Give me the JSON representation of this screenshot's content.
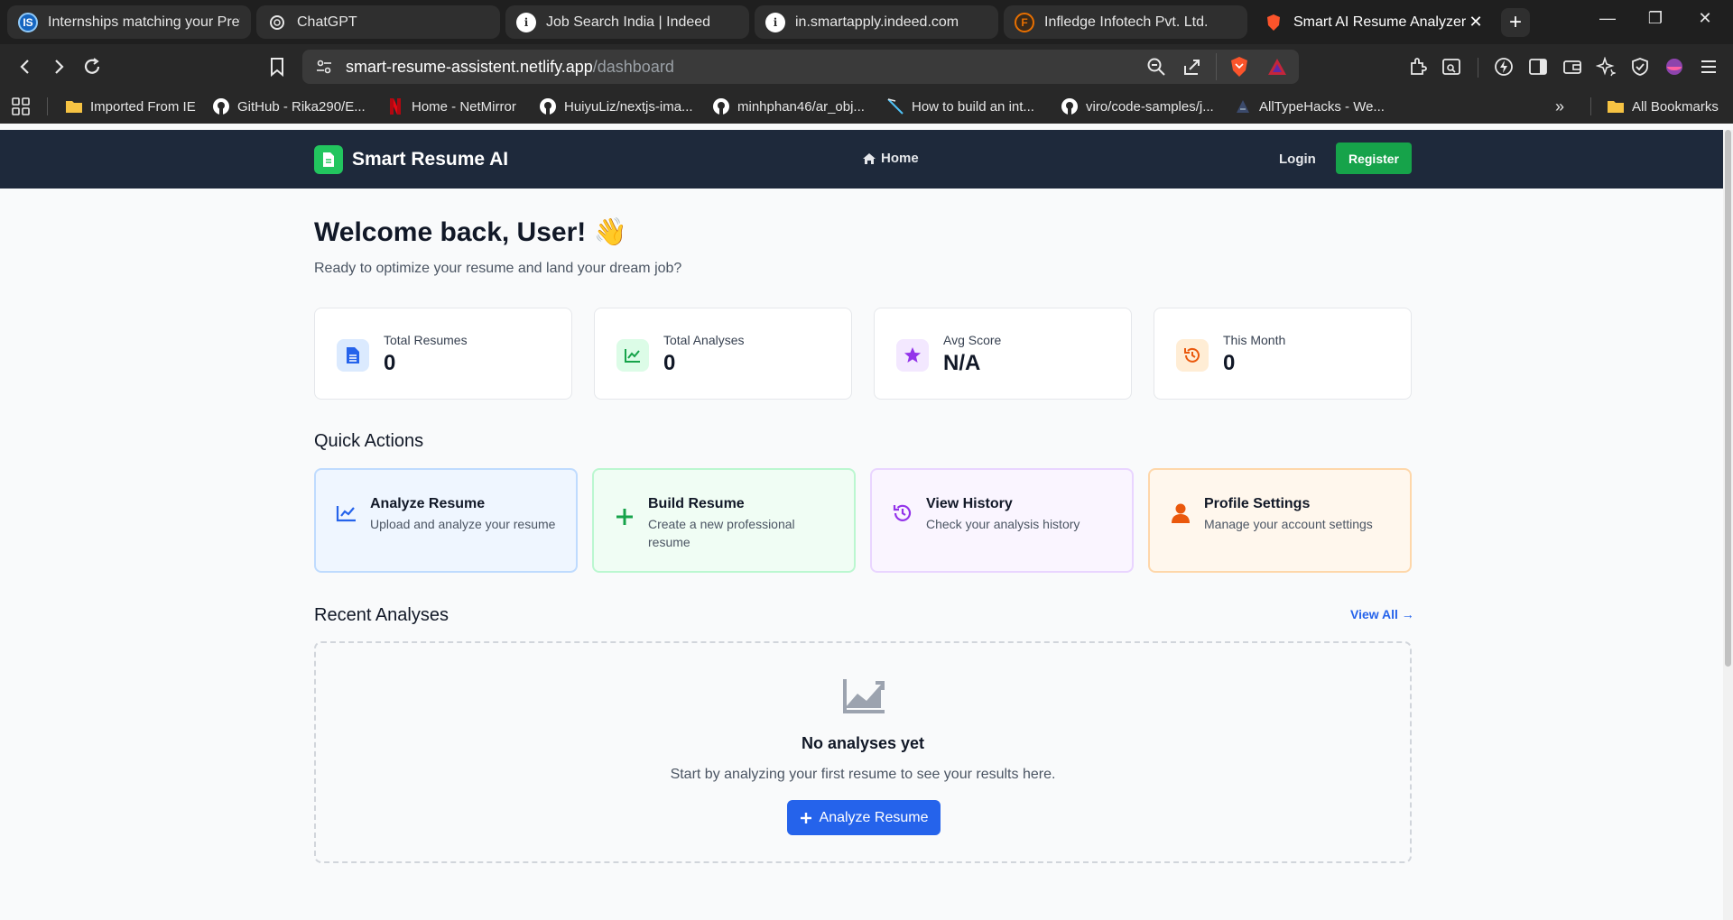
{
  "browser": {
    "tabs": [
      {
        "title": "Internships matching your Prefe",
        "favicon": "IS",
        "favicon_color": "#1565c0"
      },
      {
        "title": "ChatGPT",
        "favicon": "chatgpt-icon"
      },
      {
        "title": "Job Search India | Indeed",
        "favicon": "info-icon"
      },
      {
        "title": "in.smartapply.indeed.com",
        "favicon": "info-icon"
      },
      {
        "title": "Infledge Infotech Pvt. Ltd.",
        "favicon": "F",
        "favicon_color": "#e76f00"
      },
      {
        "title": "Smart AI Resume Analyzer",
        "favicon": "brave-icon",
        "active": true
      }
    ],
    "url": {
      "host": "smart-resume-assistent.netlify.app",
      "path": "/dashboard"
    },
    "bookmarks": [
      {
        "label": "Imported From IE",
        "icon": "folder-icon"
      },
      {
        "label": "GitHub - Rika290/E...",
        "icon": "github-icon"
      },
      {
        "label": "Home - NetMirror",
        "icon": "netflix-icon"
      },
      {
        "label": "HuiyuLiz/nextjs-ima...",
        "icon": "github-icon"
      },
      {
        "label": "minhphan46/ar_obj...",
        "icon": "github-icon"
      },
      {
        "label": "How to build an int...",
        "icon": "link-icon"
      },
      {
        "label": "viro/code-samples/j...",
        "icon": "github-icon"
      },
      {
        "label": "AllTypeHacks - We...",
        "icon": "site-icon"
      },
      {
        "label": "All Bookmarks",
        "icon": "folder-icon"
      }
    ]
  },
  "nav": {
    "brand": "Smart Resume AI",
    "home": "Home",
    "login": "Login",
    "register": "Register"
  },
  "welcome": {
    "title": "Welcome back, User! 👋",
    "subtitle": "Ready to optimize your resume and land your dream job?"
  },
  "stats": [
    {
      "label": "Total Resumes",
      "value": "0",
      "icon": "document-icon",
      "color": "#2563eb",
      "bg": "#dbeafe"
    },
    {
      "label": "Total Analyses",
      "value": "0",
      "icon": "chart-line-icon",
      "color": "#16a34a",
      "bg": "#dcfce7"
    },
    {
      "label": "Avg Score",
      "value": "N/A",
      "icon": "star-icon",
      "color": "#9333ea",
      "bg": "#f3e8ff"
    },
    {
      "label": "This Month",
      "value": "0",
      "icon": "history-icon",
      "color": "#ea580c",
      "bg": "#ffedd5"
    }
  ],
  "quick_actions": {
    "title": "Quick Actions",
    "items": [
      {
        "title": "Analyze Resume",
        "desc": "Upload and analyze your resume",
        "icon": "chart-line-icon",
        "color": "#2563eb",
        "bg": "#eff6ff",
        "border": "#bfdbfe"
      },
      {
        "title": "Build Resume",
        "desc": "Create a new professional resume",
        "icon": "plus-icon",
        "color": "#16a34a",
        "bg": "#f0fdf4",
        "border": "#bbf7d0"
      },
      {
        "title": "View History",
        "desc": "Check your analysis history",
        "icon": "history-icon",
        "color": "#9333ea",
        "bg": "#faf5ff",
        "border": "#e9d5ff"
      },
      {
        "title": "Profile Settings",
        "desc": "Manage your account settings",
        "icon": "user-icon",
        "color": "#ea580c",
        "bg": "#fff7ed",
        "border": "#fed7aa"
      }
    ]
  },
  "recent": {
    "title": "Recent Analyses",
    "view_all": "View All →",
    "empty_title": "No analyses yet",
    "empty_desc": "Start by analyzing your first resume to see your results here.",
    "empty_button": "Analyze Resume"
  }
}
